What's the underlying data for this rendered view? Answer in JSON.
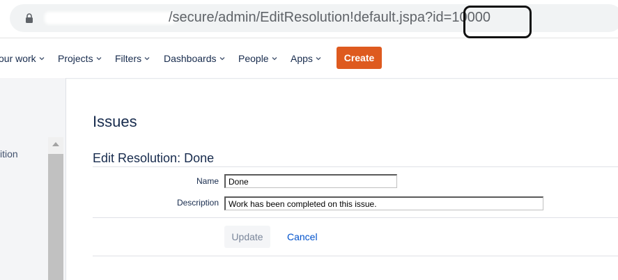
{
  "browser": {
    "url_prefix": "/secure/admin/EditResolution!default.jspa?id=",
    "url_id": "10000"
  },
  "nav": {
    "items": [
      {
        "label": "our work"
      },
      {
        "label": "Projects"
      },
      {
        "label": "Filters"
      },
      {
        "label": "Dashboards"
      },
      {
        "label": "People"
      },
      {
        "label": "Apps"
      }
    ],
    "create_label": "Create",
    "create_color": "#de5a1f"
  },
  "sidebar": {
    "partial_item": "ition"
  },
  "main": {
    "page_title": "Issues",
    "form_heading": "Edit Resolution: Done",
    "name_label": "Name",
    "name_value": "Done",
    "description_label": "Description",
    "description_value": "Work has been completed on this issue.",
    "update_label": "Update",
    "cancel_label": "Cancel"
  }
}
